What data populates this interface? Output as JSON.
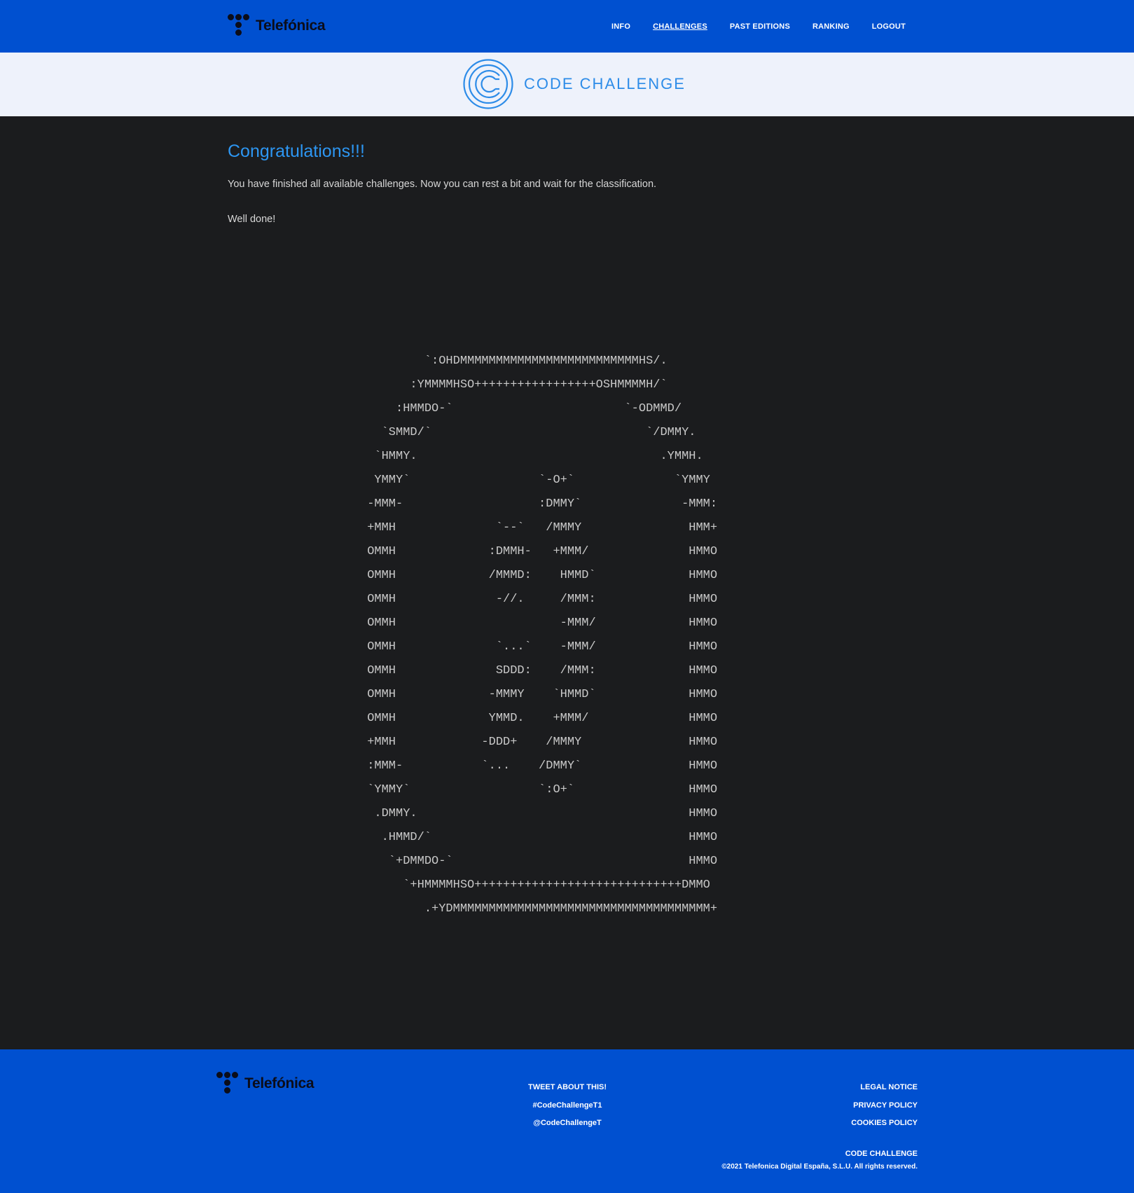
{
  "header": {
    "logo_text": "Telefónica",
    "nav": [
      {
        "label": "INFO"
      },
      {
        "label": "CHALLENGES"
      },
      {
        "label": "PAST EDITIONS"
      },
      {
        "label": "RANKING"
      },
      {
        "label": "LOGOUT"
      }
    ]
  },
  "brand": {
    "title": "CODE CHALLENGE"
  },
  "main": {
    "heading": "Congratulations!!!",
    "message": "You have finished all available challenges. Now you can rest a bit and wait for the classification.",
    "done": "Well done!",
    "ascii_art": "         `:OHDMMMMMMMMMMMMMMMMMMMMMMMMMHS/.\n       :YMMMMHSO+++++++++++++++++OSHMMMMH/`\n     :HMMDO-`                        `-ODMMD/\n   `SMMD/`                              `/DMMY.\n  `HMMY.                                  .YMMH.\n  YMMY`                  `-O+`              `YMMY\n -MMM-                   :DMMY`              -MMM:\n +MMH              `--`   /MMMY               HMM+\n OMMH             :DMMH-   +MMM/              HMMO\n OMMH             /MMMD:    HMMD`             HMMO\n OMMH              -//.     /MMM:             HMMO\n OMMH                       -MMM/             HMMO\n OMMH              `...`    -MMM/             HMMO\n OMMH              SDDD:    /MMM:             HMMO\n OMMH             -MMMY    `HMMD`             HMMO\n OMMH             YMMD.    +MMM/              HMMO\n +MMH            -DDD+    /MMMY               HMMO\n :MMM-           `...    /DMMY`               HMMO\n `YMMY`                  `:O+`                HMMO\n  .DMMY.                                      HMMO\n   .HMMD/`                                    HMMO\n    `+DMMDO-`                                 HMMO\n      `+HMMMMHSO+++++++++++++++++++++++++++++DMMO\n         .+YDMMMMMMMMMMMMMMMMMMMMMMMMMMMMMMMMMMMM+"
  },
  "footer": {
    "logo_text": "Telefónica",
    "center_links": [
      {
        "label": "TWEET ABOUT THIS!"
      },
      {
        "label": "#CodeChallengeT1"
      },
      {
        "label": "@CodeChallengeT"
      }
    ],
    "right_links": [
      {
        "label": "LEGAL NOTICE"
      },
      {
        "label": "PRIVACY POLICY"
      },
      {
        "label": "COOKIES POLICY"
      }
    ],
    "brand": "CODE CHALLENGE",
    "copyright": "©2021 Telefonica Digital España, S.L.U. All rights reserved."
  },
  "colors": {
    "header_bg": "#0050d0",
    "brand_band_bg": "#eef2fb",
    "page_bg": "#1b1c1e",
    "accent_blue": "#2d96f2",
    "logo_dark": "#0b0d1a"
  },
  "icons": [
    "telefonica-logo-icon",
    "code-challenge-logo-icon"
  ]
}
